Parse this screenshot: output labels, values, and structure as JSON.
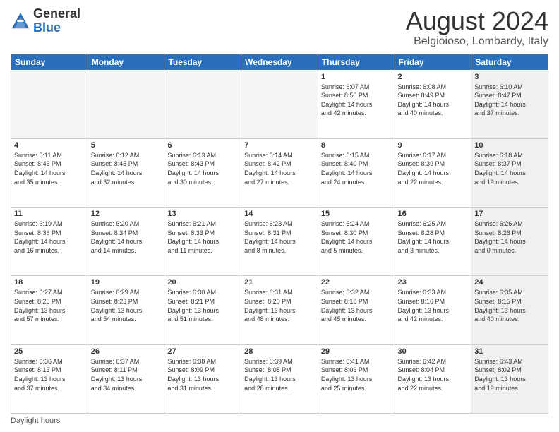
{
  "header": {
    "logo_general": "General",
    "logo_blue": "Blue",
    "month_title": "August 2024",
    "location": "Belgioioso, Lombardy, Italy"
  },
  "calendar": {
    "days_of_week": [
      "Sunday",
      "Monday",
      "Tuesday",
      "Wednesday",
      "Thursday",
      "Friday",
      "Saturday"
    ],
    "weeks": [
      [
        {
          "day": "",
          "info": "",
          "empty": true
        },
        {
          "day": "",
          "info": "",
          "empty": true
        },
        {
          "day": "",
          "info": "",
          "empty": true
        },
        {
          "day": "",
          "info": "",
          "empty": true
        },
        {
          "day": "1",
          "info": "Sunrise: 6:07 AM\nSunset: 8:50 PM\nDaylight: 14 hours\nand 42 minutes."
        },
        {
          "day": "2",
          "info": "Sunrise: 6:08 AM\nSunset: 8:49 PM\nDaylight: 14 hours\nand 40 minutes."
        },
        {
          "day": "3",
          "info": "Sunrise: 6:10 AM\nSunset: 8:47 PM\nDaylight: 14 hours\nand 37 minutes."
        }
      ],
      [
        {
          "day": "4",
          "info": "Sunrise: 6:11 AM\nSunset: 8:46 PM\nDaylight: 14 hours\nand 35 minutes."
        },
        {
          "day": "5",
          "info": "Sunrise: 6:12 AM\nSunset: 8:45 PM\nDaylight: 14 hours\nand 32 minutes."
        },
        {
          "day": "6",
          "info": "Sunrise: 6:13 AM\nSunset: 8:43 PM\nDaylight: 14 hours\nand 30 minutes."
        },
        {
          "day": "7",
          "info": "Sunrise: 6:14 AM\nSunset: 8:42 PM\nDaylight: 14 hours\nand 27 minutes."
        },
        {
          "day": "8",
          "info": "Sunrise: 6:15 AM\nSunset: 8:40 PM\nDaylight: 14 hours\nand 24 minutes."
        },
        {
          "day": "9",
          "info": "Sunrise: 6:17 AM\nSunset: 8:39 PM\nDaylight: 14 hours\nand 22 minutes."
        },
        {
          "day": "10",
          "info": "Sunrise: 6:18 AM\nSunset: 8:37 PM\nDaylight: 14 hours\nand 19 minutes."
        }
      ],
      [
        {
          "day": "11",
          "info": "Sunrise: 6:19 AM\nSunset: 8:36 PM\nDaylight: 14 hours\nand 16 minutes."
        },
        {
          "day": "12",
          "info": "Sunrise: 6:20 AM\nSunset: 8:34 PM\nDaylight: 14 hours\nand 14 minutes."
        },
        {
          "day": "13",
          "info": "Sunrise: 6:21 AM\nSunset: 8:33 PM\nDaylight: 14 hours\nand 11 minutes."
        },
        {
          "day": "14",
          "info": "Sunrise: 6:23 AM\nSunset: 8:31 PM\nDaylight: 14 hours\nand 8 minutes."
        },
        {
          "day": "15",
          "info": "Sunrise: 6:24 AM\nSunset: 8:30 PM\nDaylight: 14 hours\nand 5 minutes."
        },
        {
          "day": "16",
          "info": "Sunrise: 6:25 AM\nSunset: 8:28 PM\nDaylight: 14 hours\nand 3 minutes."
        },
        {
          "day": "17",
          "info": "Sunrise: 6:26 AM\nSunset: 8:26 PM\nDaylight: 14 hours\nand 0 minutes."
        }
      ],
      [
        {
          "day": "18",
          "info": "Sunrise: 6:27 AM\nSunset: 8:25 PM\nDaylight: 13 hours\nand 57 minutes."
        },
        {
          "day": "19",
          "info": "Sunrise: 6:29 AM\nSunset: 8:23 PM\nDaylight: 13 hours\nand 54 minutes."
        },
        {
          "day": "20",
          "info": "Sunrise: 6:30 AM\nSunset: 8:21 PM\nDaylight: 13 hours\nand 51 minutes."
        },
        {
          "day": "21",
          "info": "Sunrise: 6:31 AM\nSunset: 8:20 PM\nDaylight: 13 hours\nand 48 minutes."
        },
        {
          "day": "22",
          "info": "Sunrise: 6:32 AM\nSunset: 8:18 PM\nDaylight: 13 hours\nand 45 minutes."
        },
        {
          "day": "23",
          "info": "Sunrise: 6:33 AM\nSunset: 8:16 PM\nDaylight: 13 hours\nand 42 minutes."
        },
        {
          "day": "24",
          "info": "Sunrise: 6:35 AM\nSunset: 8:15 PM\nDaylight: 13 hours\nand 40 minutes."
        }
      ],
      [
        {
          "day": "25",
          "info": "Sunrise: 6:36 AM\nSunset: 8:13 PM\nDaylight: 13 hours\nand 37 minutes."
        },
        {
          "day": "26",
          "info": "Sunrise: 6:37 AM\nSunset: 8:11 PM\nDaylight: 13 hours\nand 34 minutes."
        },
        {
          "day": "27",
          "info": "Sunrise: 6:38 AM\nSunset: 8:09 PM\nDaylight: 13 hours\nand 31 minutes."
        },
        {
          "day": "28",
          "info": "Sunrise: 6:39 AM\nSunset: 8:08 PM\nDaylight: 13 hours\nand 28 minutes."
        },
        {
          "day": "29",
          "info": "Sunrise: 6:41 AM\nSunset: 8:06 PM\nDaylight: 13 hours\nand 25 minutes."
        },
        {
          "day": "30",
          "info": "Sunrise: 6:42 AM\nSunset: 8:04 PM\nDaylight: 13 hours\nand 22 minutes."
        },
        {
          "day": "31",
          "info": "Sunrise: 6:43 AM\nSunset: 8:02 PM\nDaylight: 13 hours\nand 19 minutes."
        }
      ]
    ]
  },
  "footer": {
    "daylight_label": "Daylight hours"
  }
}
